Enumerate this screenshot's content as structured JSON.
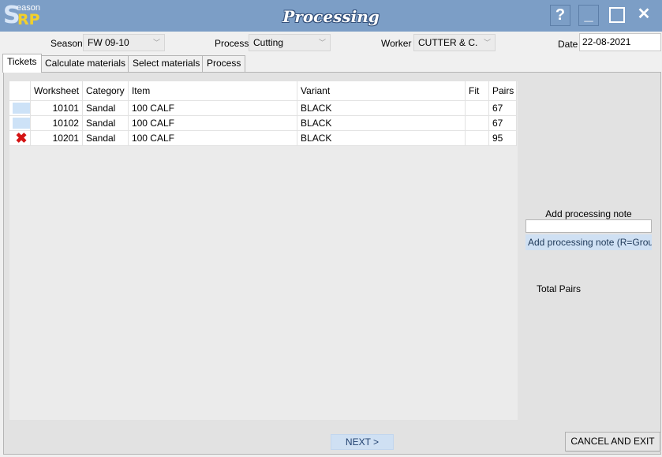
{
  "app": {
    "logo_small": "eason",
    "logo_s": "S",
    "logo_rp": "RP",
    "title": "Processing",
    "help_label": "?",
    "minimize_label": "_",
    "close_label": "✕"
  },
  "filters": {
    "season_label": "Season",
    "season_value": "FW 09-10",
    "process_label": "Process",
    "process_value": "Cutting",
    "worker_label": "Worker",
    "worker_value": "CUTTER & C.",
    "date_label": "Date",
    "date_value": "22-08-2021"
  },
  "tabs": [
    {
      "label": "Tickets"
    },
    {
      "label": "Calculate materials"
    },
    {
      "label": "Select materials"
    },
    {
      "label": "Process"
    }
  ],
  "table": {
    "columns": [
      "",
      "Worksheet",
      "Category",
      "Item",
      "Variant",
      "Fit",
      "Pairs"
    ],
    "rows": [
      {
        "status": "selected",
        "worksheet": "10101",
        "category": "Sandal",
        "item": "100 CALF",
        "variant": "BLACK",
        "fit": "",
        "pairs": "67"
      },
      {
        "status": "selected",
        "worksheet": "10102",
        "category": "Sandal",
        "item": "100 CALF",
        "variant": "BLACK",
        "fit": "",
        "pairs": "67"
      },
      {
        "status": "removed",
        "worksheet": "10201",
        "category": "Sandal",
        "item": "100 CALF",
        "variant": "BLACK",
        "fit": "",
        "pairs": "95"
      }
    ]
  },
  "side": {
    "note_label": "Add processing note",
    "note_value": "",
    "note_button": "Add processing note (R=Grou",
    "total_label": "Total Pairs"
  },
  "footer": {
    "next_label": "NEXT >",
    "cancel_label": "CANCEL AND EXIT"
  },
  "colors": {
    "titlebar": "#7c9ec6",
    "accent": "#cfe0f3",
    "remove": "#d41414"
  }
}
